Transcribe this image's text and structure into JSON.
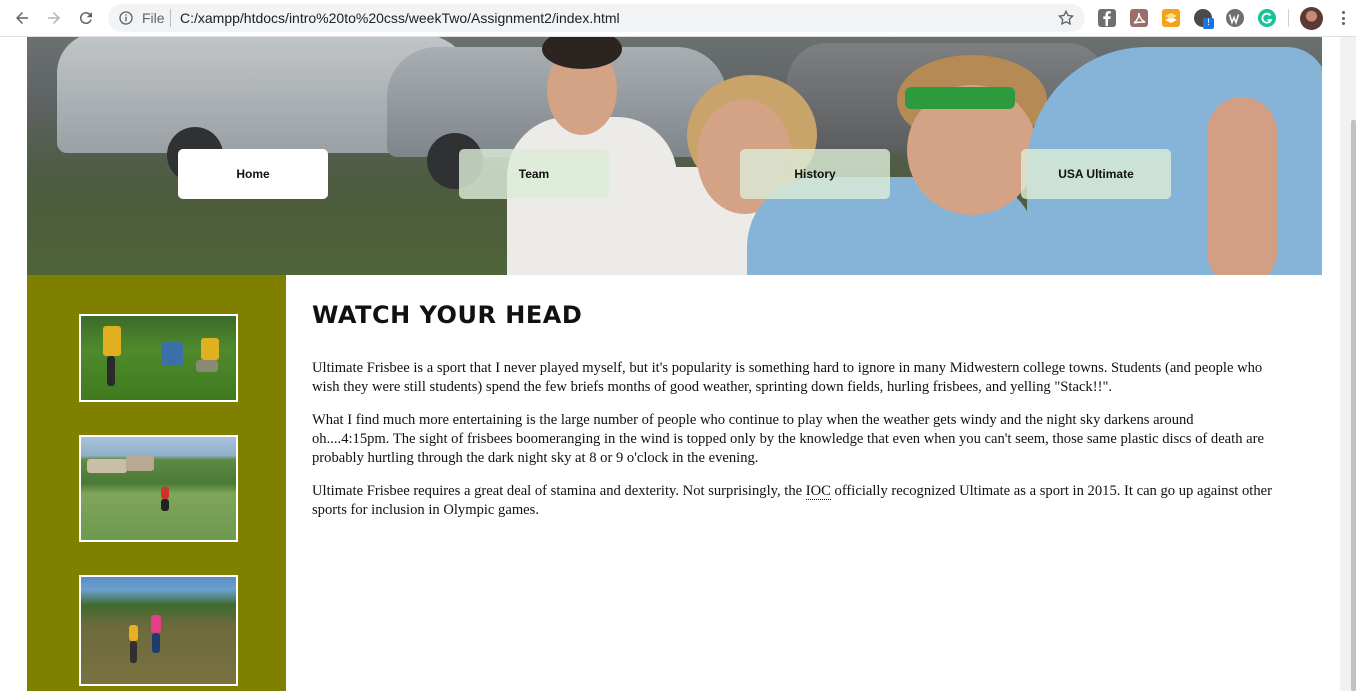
{
  "browser": {
    "file_label": "File",
    "url": "C:/xampp/htdocs/intro%20to%20css/weekTwo/Assignment2/index.html",
    "icons": [
      "back-icon",
      "forward-icon",
      "reload-icon",
      "info-icon",
      "star-icon",
      "facebook-icon",
      "pdf-icon",
      "layers-icon",
      "camera-icon",
      "wordpress-icon",
      "grammarly-icon",
      "kebab-menu-icon"
    ]
  },
  "nav": {
    "items": [
      {
        "label": "Home",
        "active": true
      },
      {
        "label": "Team",
        "active": false
      },
      {
        "label": "History",
        "active": false
      },
      {
        "label": "USA Ultimate",
        "active": false
      }
    ]
  },
  "main": {
    "heading": "WATCH YOUR HEAD",
    "paragraphs": [
      "Ultimate Frisbee is a sport that I never played myself, but it's popularity is something hard to ignore in many Midwestern college towns. Students (and people who wish they were still students) spend the few briefs months of good weather, sprinting down fields, hurling frisbees, and yelling \"Stack!!\".",
      "What I find much more entertaining is the large number of people who continue to play when the weather gets windy and the night sky darkens around oh....4:15pm. The sight of frisbees boomeranging in the wind is topped only by the knowledge that even when you can't seem, those same plastic discs of death are probably hurtling through the dark night sky at 8 or 9 o'clock in the evening."
    ],
    "p3": {
      "before": "Ultimate Frisbee requires a great deal of stamina and dexterity. Not surprisingly, the ",
      "abbr": "IOC",
      "after": " officially recognized Ultimate as a sport in 2015. It can go up against other sports for inclusion in Olympic games."
    }
  },
  "colors": {
    "sidebar": "#808000",
    "nav_active": "#ffffff",
    "nav_inactive": "#dcebd7"
  }
}
